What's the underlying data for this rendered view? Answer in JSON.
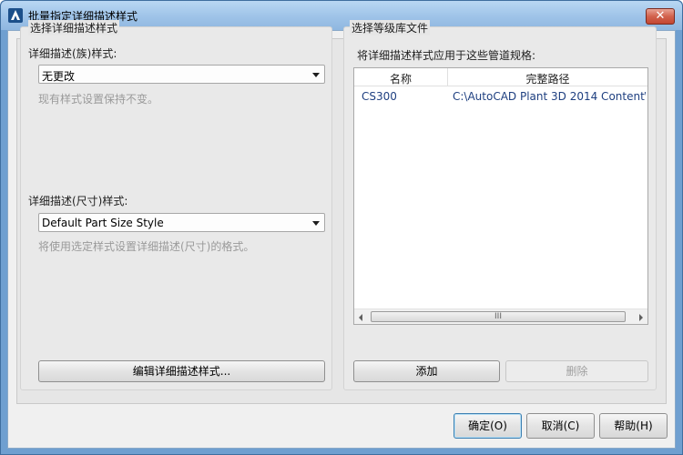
{
  "window": {
    "title": "批量指定详细描述样式",
    "close_glyph": "✕"
  },
  "left": {
    "group_title": "选择详细描述样式",
    "family_label": "详细描述(族)样式:",
    "family_value": "无更改",
    "family_hint": "现有样式设置保持不变。",
    "size_label": "详细描述(尺寸)样式:",
    "size_value": "Default Part Size Style",
    "size_hint": "将使用选定样式设置详细描述(尺寸)的格式。",
    "edit_button": "编辑详细描述样式..."
  },
  "right": {
    "group_title": "选择等级库文件",
    "apply_label": "将详细描述样式应用于这些管道规格:",
    "columns": [
      "名称",
      "完整路径"
    ],
    "rows": [
      {
        "name": "CS300",
        "path": "C:\\AutoCAD Plant 3D 2014 Content\\"
      }
    ],
    "scroll_grip": "III",
    "add_button": "添加",
    "delete_button": "删除"
  },
  "footer": {
    "ok": "确定(O)",
    "cancel": "取消(C)",
    "help": "帮助(H)"
  },
  "icons": {
    "app": "autocad-app-icon",
    "close": "close-icon"
  },
  "colors": {
    "title_bar": "#9ec3e8",
    "close_button": "#c34632",
    "path_text": "#1e3f80",
    "hint_text": "#9a9a9a"
  }
}
